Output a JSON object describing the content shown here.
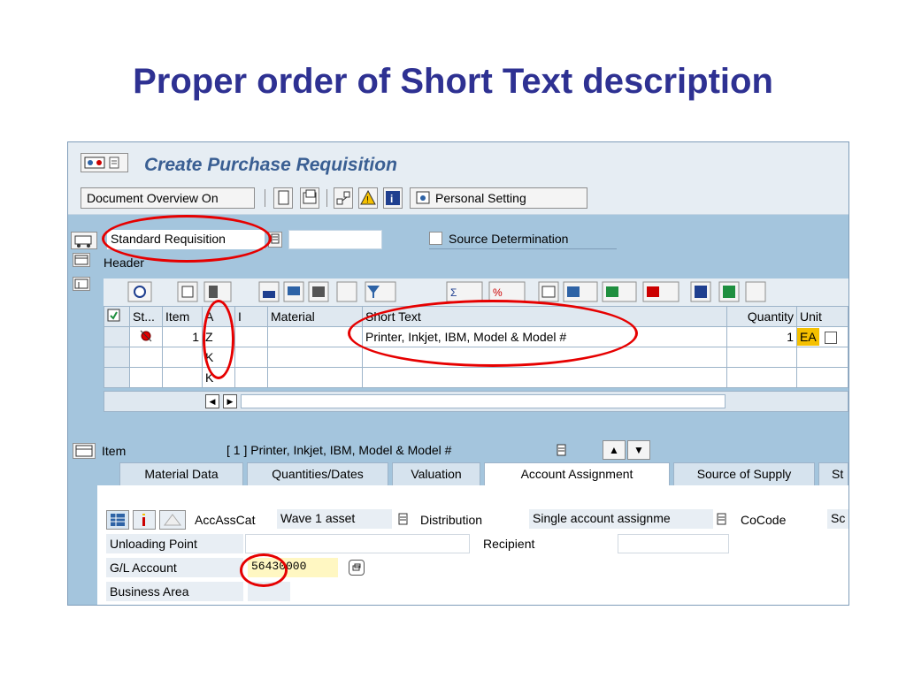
{
  "slide": {
    "title": "Proper order of Short Text description"
  },
  "window": {
    "title": "Create Purchase Requisition"
  },
  "toolbar": {
    "document_overview_label": "Document Overview On",
    "personal_setting_label": "Personal Setting"
  },
  "header": {
    "doc_type_value": "Standard Requisition",
    "source_determination_label": "Source Determination",
    "header_label": "Header"
  },
  "grid": {
    "columns": [
      "St...",
      "Item",
      "A",
      "I",
      "Material",
      "Short Text",
      "Quantity",
      "Unit"
    ],
    "rows": [
      {
        "item": "1",
        "a": "Z",
        "i": "",
        "material": "",
        "short_text": "Printer, Inkjet, IBM, Model & Model #",
        "quantity": "1",
        "unit": "EA"
      },
      {
        "item": "",
        "a": "K",
        "i": "",
        "material": "",
        "short_text": "",
        "quantity": "",
        "unit": ""
      },
      {
        "item": "",
        "a": "K",
        "i": "",
        "material": "",
        "short_text": "",
        "quantity": "",
        "unit": ""
      }
    ]
  },
  "item_section": {
    "label": "Item",
    "selected_item": "[ 1 ] Printer, Inkjet, IBM, Model & Model #"
  },
  "tabs": [
    "Material Data",
    "Quantities/Dates",
    "Valuation",
    "Account Assignment",
    "Source of Supply",
    "St"
  ],
  "account": {
    "accasscat_label": "AccAssCat",
    "accasscat_value": "Wave 1 asset",
    "distribution_label": "Distribution",
    "distribution_value": "Single account assignme",
    "cocode_label": "CoCode",
    "cocode_value": "Sc",
    "unloading_point_label": "Unloading Point",
    "recipient_label": "Recipient",
    "gl_account_label": "G/L Account",
    "gl_account_value": "56430000",
    "business_area_label": "Business Area"
  },
  "colors": {
    "title": "#2e3192",
    "sap_bg": "#a4c5dd",
    "app_title": "#3a5f93",
    "highlight_ring": "#e60000",
    "unit_bg": "#f5c000"
  }
}
